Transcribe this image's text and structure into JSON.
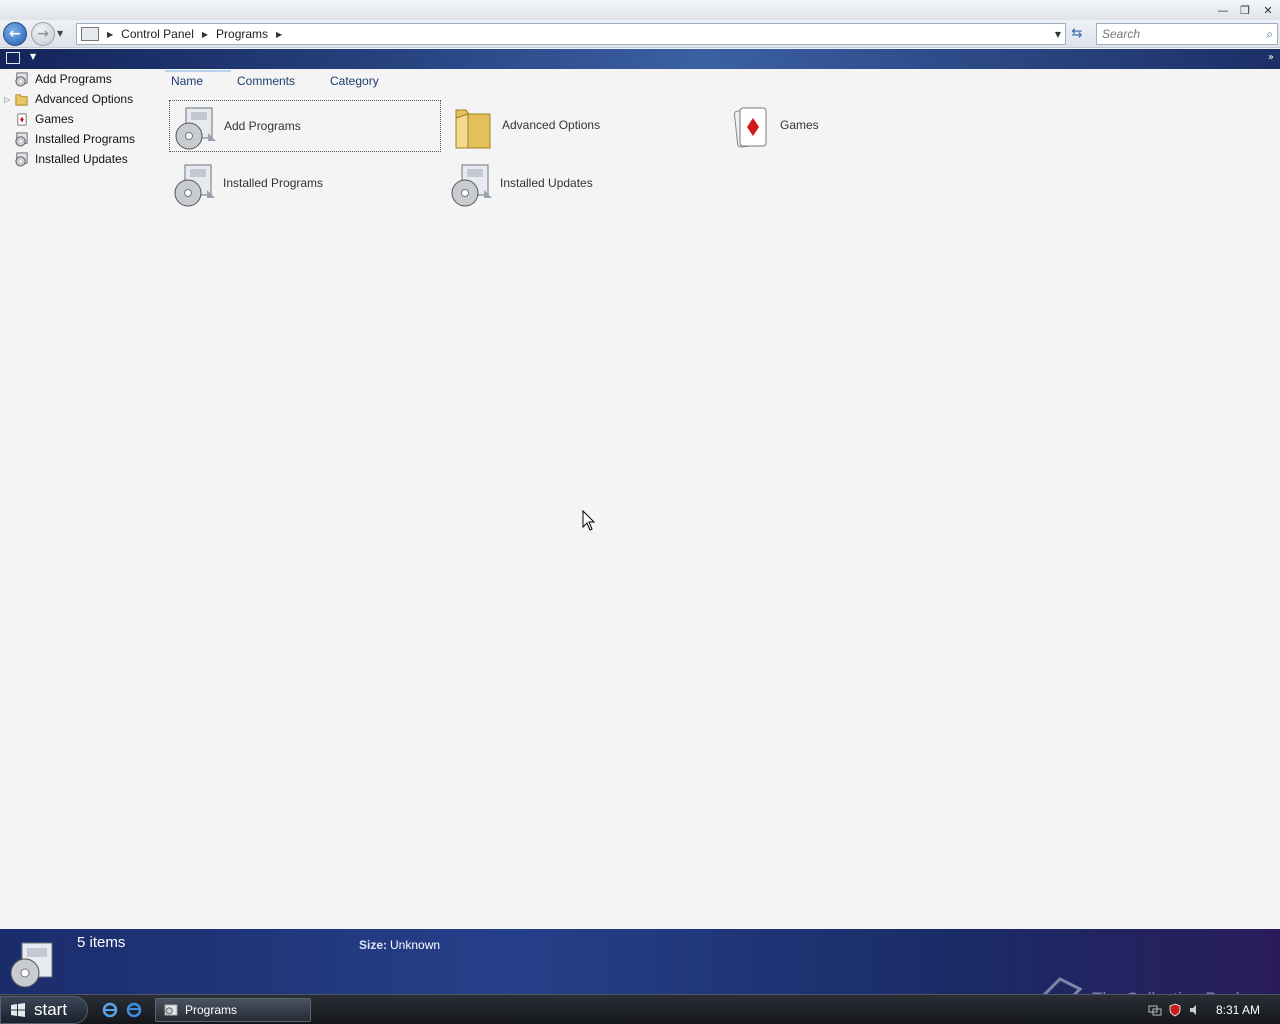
{
  "window": {
    "buttons": {
      "minimize": "—",
      "restore": "❐",
      "close": "✕"
    }
  },
  "nav": {
    "back_glyph": "←",
    "forward_glyph": "→",
    "breadcrumb": [
      {
        "label": "Control Panel"
      },
      {
        "label": "Programs"
      }
    ],
    "search": {
      "placeholder": "Search",
      "value": ""
    }
  },
  "tree": [
    {
      "label": "Add Programs",
      "icon": "installer-icon",
      "expandable": false
    },
    {
      "label": "Advanced Options",
      "icon": "folder-icon",
      "expandable": true
    },
    {
      "label": "Games",
      "icon": "games-icon",
      "expandable": false
    },
    {
      "label": "Installed Programs",
      "icon": "installer-icon",
      "expandable": false
    },
    {
      "label": "Installed Updates",
      "icon": "installer-icon",
      "expandable": false
    }
  ],
  "columns": [
    {
      "label": "Name"
    },
    {
      "label": "Comments"
    },
    {
      "label": "Category"
    }
  ],
  "items": [
    {
      "label": "Add Programs",
      "icon": "installer-icon",
      "selected": true
    },
    {
      "label": "Advanced Options",
      "icon": "folder-icon",
      "selected": false
    },
    {
      "label": "Games",
      "icon": "playing-card-icon",
      "selected": false
    },
    {
      "label": "Installed Programs",
      "icon": "installer-icon",
      "selected": false
    },
    {
      "label": "Installed Updates",
      "icon": "installer-icon",
      "selected": false
    }
  ],
  "details": {
    "count": "5 items",
    "size_label": "Size:",
    "size_value": "Unknown"
  },
  "taskbar": {
    "start_label": "start",
    "task_label": "Programs",
    "clock": "8:31 AM"
  },
  "watermark": {
    "text": "The Collection Book"
  },
  "colors": {
    "toolbar": "#26427f",
    "details_bar": "#25408a",
    "accent": "#1f5fb5"
  }
}
